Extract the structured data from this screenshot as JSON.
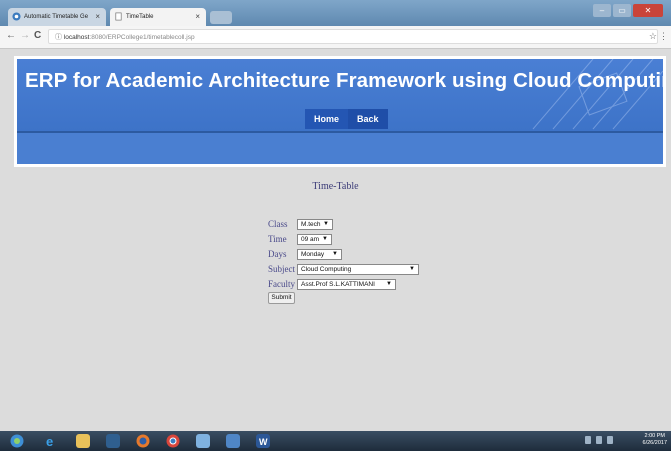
{
  "browser": {
    "tabs": [
      {
        "label": "Automatic Timetable Ge",
        "close": "×"
      },
      {
        "label": "TimeTable",
        "close": "×"
      }
    ],
    "window_buttons": {
      "minimize": "–",
      "maximize": "▭",
      "close": "✕"
    },
    "nav": {
      "back": "←",
      "forward": "→",
      "reload": "C"
    },
    "address": {
      "host": "localhost",
      "path": ":8080/ERPCollege1/timetablecoll.jsp"
    },
    "star": "☆",
    "menu": "⋮"
  },
  "header": {
    "title": "ERP for Academic Architecture Framework using Cloud Computing",
    "nav": [
      {
        "label": "Home"
      },
      {
        "label": "Back"
      }
    ]
  },
  "page": {
    "title": "Time-Table",
    "form": {
      "class": {
        "label": "Class",
        "value": "M.tech"
      },
      "time": {
        "label": "Time",
        "value": "09 am"
      },
      "days": {
        "label": "Days",
        "value": "Monday"
      },
      "subject": {
        "label": "Subject",
        "value": "Cloud Computing"
      },
      "faculty": {
        "label": "Faculty",
        "value": "Asst.Prof  S.L.KATTIMANI"
      },
      "submit": "Submit"
    }
  },
  "taskbar": {
    "time": "2:00 PM",
    "date": "6/26/2017"
  },
  "colors": {
    "header_blue": "#4a7fd1",
    "menu_blue": "#1f4ea8",
    "label_purple": "#4a4a8a"
  }
}
